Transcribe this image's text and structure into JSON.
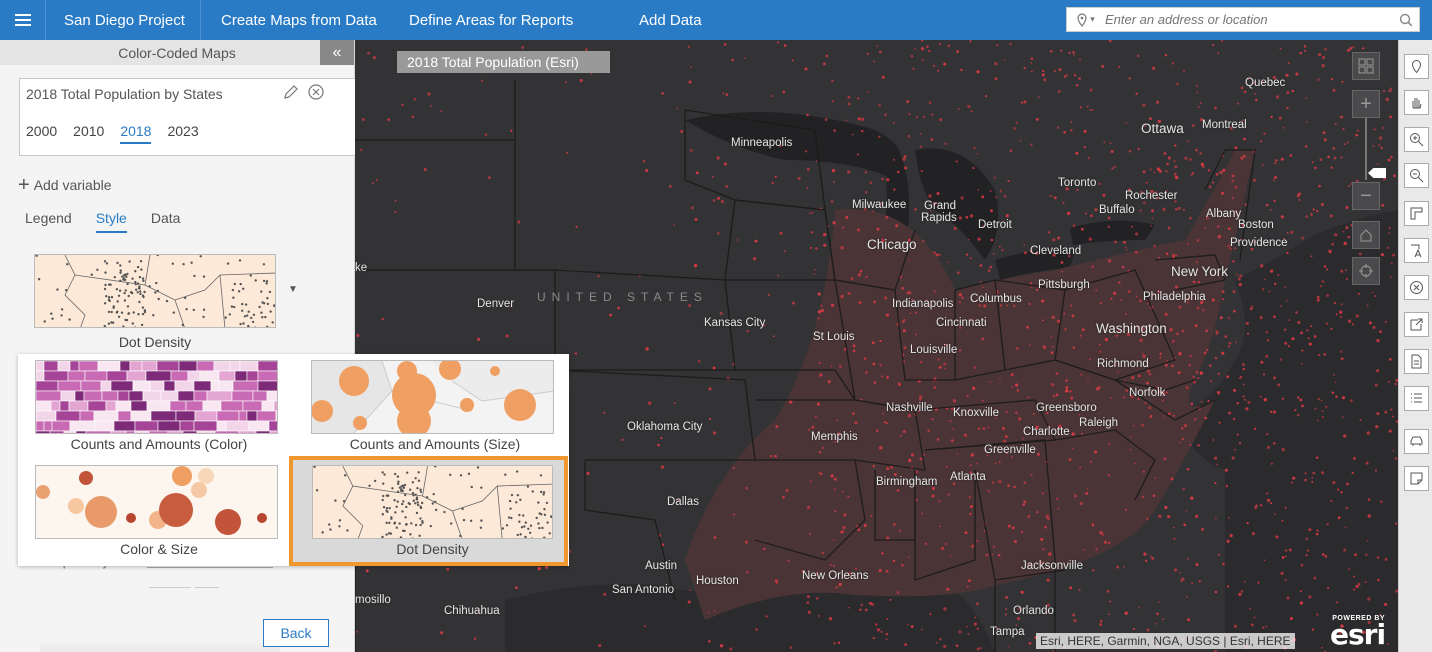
{
  "topbar": {
    "project": "San Diego Project",
    "tabs": [
      "Create Maps from Data",
      "Define Areas for Reports",
      "Add Data"
    ],
    "search_placeholder": "Enter an address or location",
    "brand_color": "#2a7bc6"
  },
  "panel": {
    "title": "Color-Coded Maps",
    "variable_title": "2018 Total Population by States",
    "years": [
      "2000",
      "2010",
      "2018",
      "2023"
    ],
    "selected_year": "2018",
    "add_variable": "Add variable",
    "tabs": [
      "Legend",
      "Style",
      "Data"
    ],
    "active_tab": "Style",
    "current_style": "Dot Density",
    "transparency_label": "Transparency",
    "back": "Back"
  },
  "style_options": [
    {
      "label": "Counts and Amounts (Color)"
    },
    {
      "label": "Counts and Amounts (Size)"
    },
    {
      "label": "Color & Size"
    },
    {
      "label": "Dot Density",
      "selected": true
    }
  ],
  "map": {
    "title": "2018 Total Population (Esri)",
    "country_label": "UNITED STATES",
    "attribution": "Esri, HERE, Garmin, NGA, USGS | Esri, HERE",
    "powered_by": "POWERED BY",
    "logo_text": "esri",
    "dot_color": "#e03a45",
    "cities": [
      {
        "name": "Quebec"
      },
      {
        "name": "Ottawa",
        "big": true
      },
      {
        "name": "Montreal"
      },
      {
        "name": "Minneapolis"
      },
      {
        "name": "Toronto"
      },
      {
        "name": "Rochester"
      },
      {
        "name": "Buffalo"
      },
      {
        "name": "Albany"
      },
      {
        "name": "Milwaukee"
      },
      {
        "name": "Grand"
      },
      {
        "name": "Rapids"
      },
      {
        "name": "Detroit"
      },
      {
        "name": "Boston"
      },
      {
        "name": "Providence"
      },
      {
        "name": "Chicago",
        "big": true
      },
      {
        "name": "Cleveland"
      },
      {
        "name": "Pittsburgh"
      },
      {
        "name": "New York",
        "big": true
      },
      {
        "name": "Denver"
      },
      {
        "name": "Columbus"
      },
      {
        "name": "Philadelphia"
      },
      {
        "name": "Indianapolis"
      },
      {
        "name": "Kansas City"
      },
      {
        "name": "Cincinnati"
      },
      {
        "name": "Washington",
        "big": true
      },
      {
        "name": "St Louis"
      },
      {
        "name": "Louisville"
      },
      {
        "name": "Richmond"
      },
      {
        "name": "Norfolk"
      },
      {
        "name": "Nashville"
      },
      {
        "name": "Knoxville"
      },
      {
        "name": "Greensboro"
      },
      {
        "name": "Oklahoma City"
      },
      {
        "name": "Charlotte"
      },
      {
        "name": "Raleigh"
      },
      {
        "name": "Memphis"
      },
      {
        "name": "Greenville"
      },
      {
        "name": "Birmingham"
      },
      {
        "name": "Atlanta"
      },
      {
        "name": "Dallas"
      },
      {
        "name": "Austin"
      },
      {
        "name": "Houston"
      },
      {
        "name": "Jacksonville"
      },
      {
        "name": "New Orleans"
      },
      {
        "name": "San Antonio"
      },
      {
        "name": "Orlando"
      },
      {
        "name": "Chihuahua"
      },
      {
        "name": "mosillo"
      },
      {
        "name": "Tampa"
      },
      {
        "name": "ke"
      }
    ]
  }
}
